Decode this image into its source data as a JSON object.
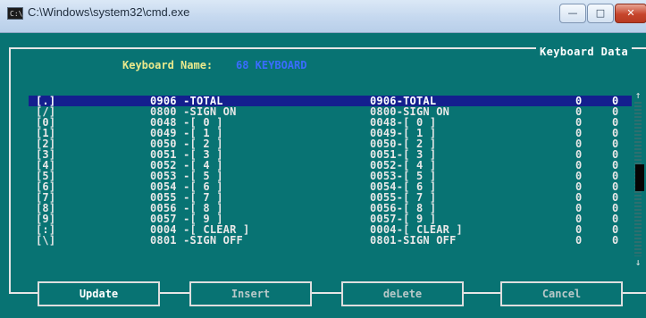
{
  "window": {
    "title": "C:\\Windows\\system32\\cmd.exe",
    "icon_text": "C:\\",
    "minimize_glyph": "—",
    "maximize_glyph": "□",
    "close_glyph": "✕"
  },
  "panel": {
    "title": "Keyboard Data",
    "keyboard_name_label": "Keyboard Name:",
    "keyboard_name_value": "68 KEYBOARD"
  },
  "rows": [
    {
      "key": "[.]",
      "code": "0906 -TOTAL",
      "desc": "0906-TOTAL",
      "v1": "0",
      "v2": "0"
    },
    {
      "key": "[/]",
      "code": "0800 -SIGN ON",
      "desc": "0800-SIGN ON",
      "v1": "0",
      "v2": "0"
    },
    {
      "key": "[0]",
      "code": "0048 -[ 0 ]",
      "desc": "0048-[ 0 ]",
      "v1": "0",
      "v2": "0"
    },
    {
      "key": "[1]",
      "code": "0049 -[ 1 ]",
      "desc": "0049-[ 1 ]",
      "v1": "0",
      "v2": "0"
    },
    {
      "key": "[2]",
      "code": "0050 -[ 2 ]",
      "desc": "0050-[ 2 ]",
      "v1": "0",
      "v2": "0"
    },
    {
      "key": "[3]",
      "code": "0051 -[ 3 ]",
      "desc": "0051-[ 3 ]",
      "v1": "0",
      "v2": "0"
    },
    {
      "key": "[4]",
      "code": "0052 -[ 4 ]",
      "desc": "0052-[ 4 ]",
      "v1": "0",
      "v2": "0"
    },
    {
      "key": "[5]",
      "code": "0053 -[ 5 ]",
      "desc": "0053-[ 5 ]",
      "v1": "0",
      "v2": "0"
    },
    {
      "key": "[6]",
      "code": "0054 -[ 6 ]",
      "desc": "0054-[ 6 ]",
      "v1": "0",
      "v2": "0"
    },
    {
      "key": "[7]",
      "code": "0055 -[ 7 ]",
      "desc": "0055-[ 7 ]",
      "v1": "0",
      "v2": "0"
    },
    {
      "key": "[8]",
      "code": "0056 -[ 8 ]",
      "desc": "0056-[ 8 ]",
      "v1": "0",
      "v2": "0"
    },
    {
      "key": "[9]",
      "code": "0057 -[ 9 ]",
      "desc": "0057-[ 9 ]",
      "v1": "0",
      "v2": "0"
    },
    {
      "key": "[:]",
      "code": "0004 -[ CLEAR ]",
      "desc": "0004-[ CLEAR ]",
      "v1": "0",
      "v2": "0"
    },
    {
      "key": "[\\]",
      "code": "0801 -SIGN OFF",
      "desc": "0801-SIGN OFF",
      "v1": "0",
      "v2": "0"
    }
  ],
  "scrollbar": {
    "up_glyph": "↑",
    "down_glyph": "↓"
  },
  "buttons": {
    "update": "Update",
    "insert": "Insert",
    "delete": "deLete",
    "cancel": "Cancel"
  },
  "colors": {
    "console_bg": "#087373",
    "selected_row_bg": "#141f8e",
    "label_yellow": "#e9e98c",
    "name_blue": "#3a6cff"
  }
}
